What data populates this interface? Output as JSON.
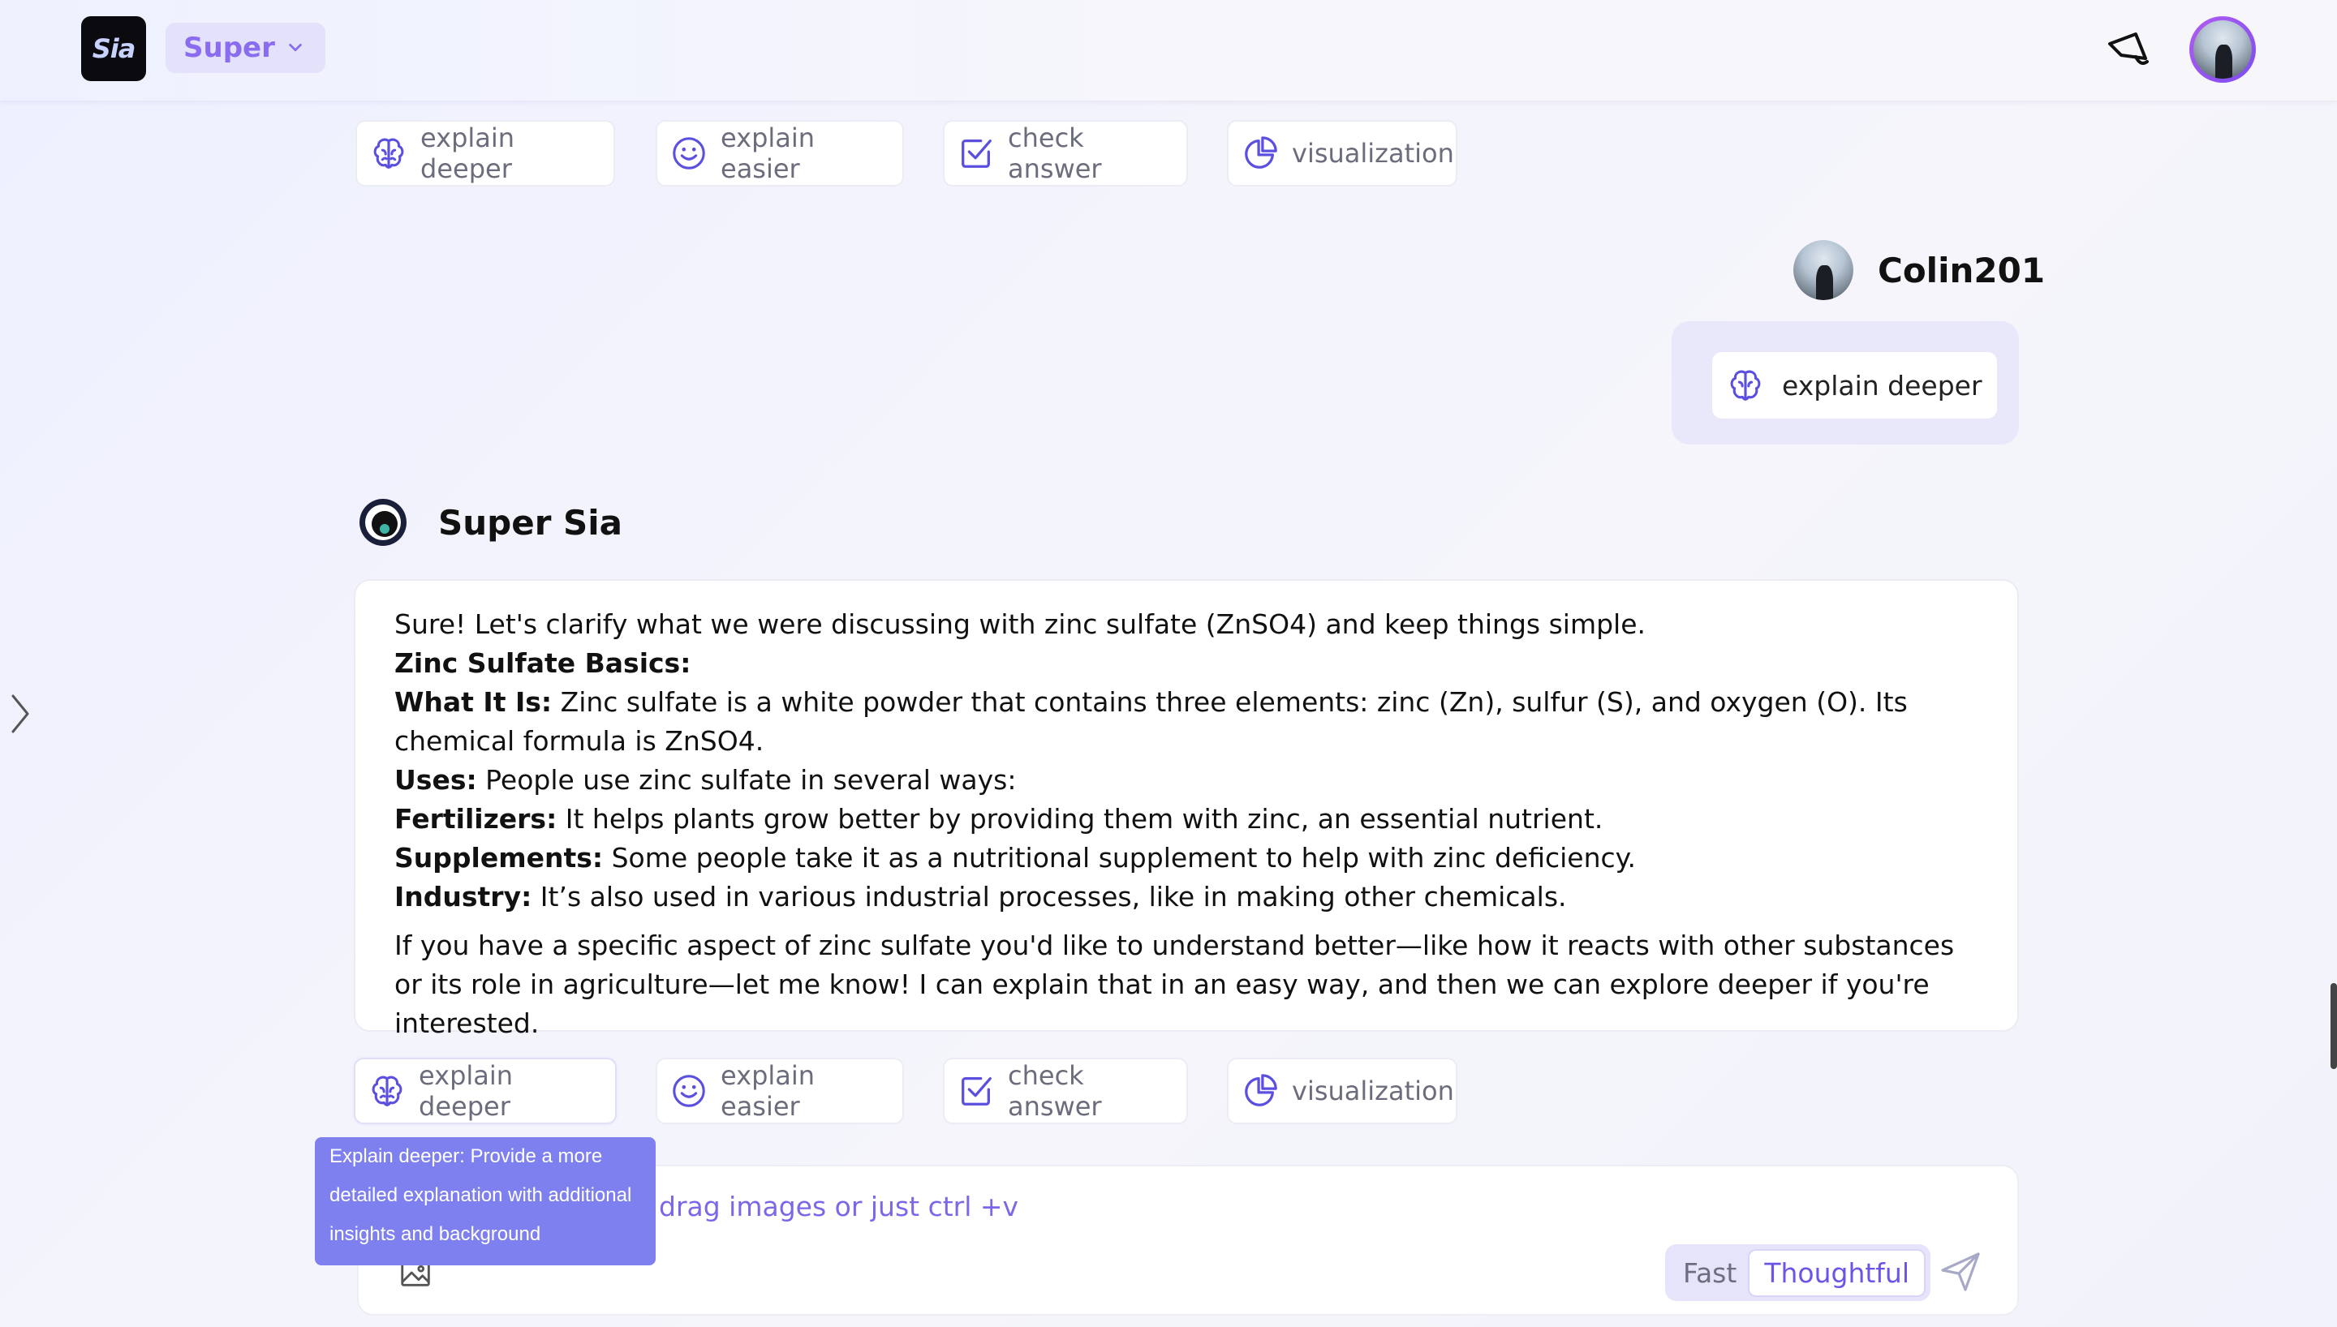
{
  "header": {
    "logo_text": "Sia",
    "mode_label": "Super"
  },
  "actions": {
    "explain_deeper": "explain deeper",
    "explain_easier": "explain easier",
    "check_answer": "check answer",
    "visualization": "visualization"
  },
  "user_message": {
    "name": "Colin201",
    "chip_label": "explain deeper"
  },
  "bot": {
    "name": "Super Sia",
    "intro": "Sure! Let's clarify what we were discussing with zinc sulfate (ZnSO4) and keep things simple.",
    "heading": "Zinc Sulfate Basics:",
    "what_label": "What It Is:",
    "what_text": " Zinc sulfate is a white powder that contains three elements: zinc (Zn), sulfur (S), and oxygen (O). Its chemical formula is ZnSO4.",
    "uses_label": "Uses:",
    "uses_text": " People use zinc sulfate in several ways:",
    "fert_label": "Fertilizers:",
    "fert_text": " It helps plants grow better by providing them with zinc, an essential nutrient.",
    "supp_label": "Supplements:",
    "supp_text": " Some people take it as a nutritional supplement to help with zinc deficiency.",
    "ind_label": "Industry:",
    "ind_text": " It’s also used in various industrial processes, like in making other chemicals.",
    "closing": "If you have a specific aspect of zinc sulfate you'd like to understand better—like how it reacts with other substances or its role in agriculture—let me know! I can explain that in an easy way, and then we can explore deeper if you're interested."
  },
  "composer": {
    "placeholder": "drag images or just ctrl +v",
    "speed_fast": "Fast",
    "speed_thoughtful": "Thoughtful"
  },
  "tooltip": {
    "text": "Explain deeper: Provide a more detailed explanation with additional insights and background"
  },
  "colors": {
    "accent": "#6b55e8",
    "icon": "#5b4fe0",
    "tooltip_bg": "#7f80f0"
  }
}
